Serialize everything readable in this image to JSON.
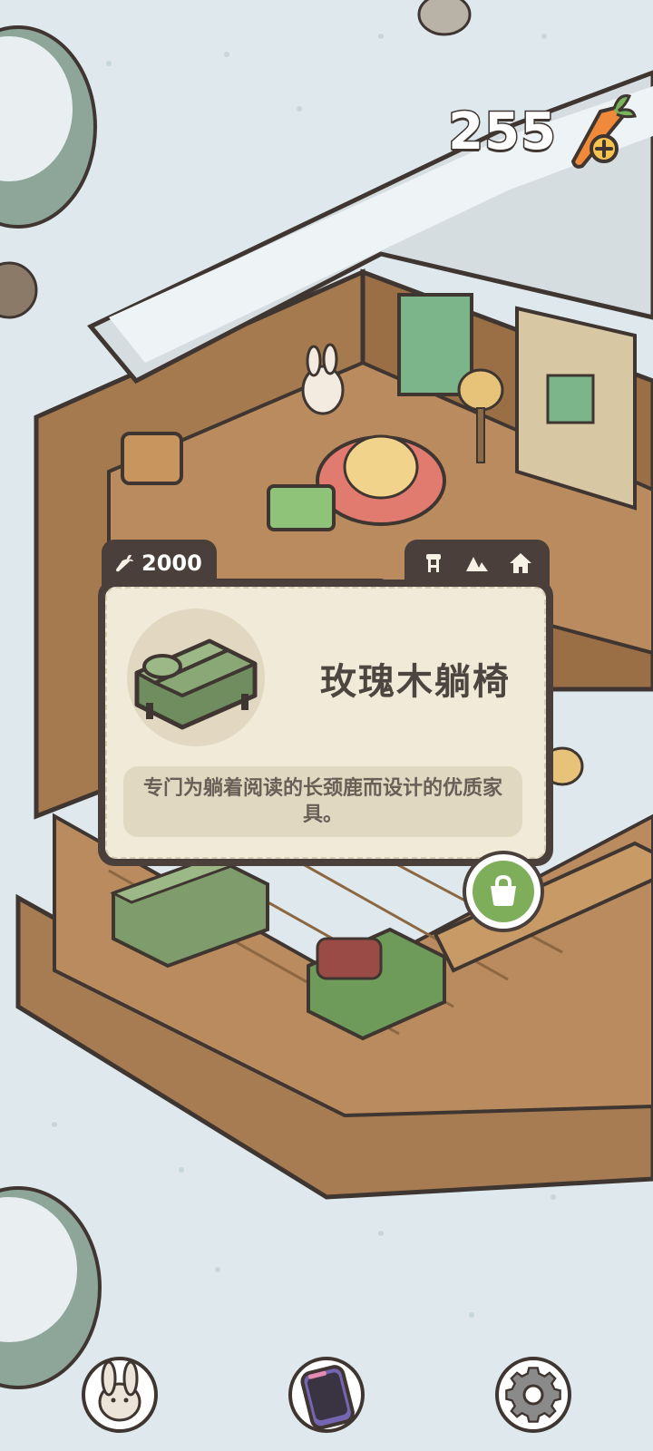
{
  "hud": {
    "carrot_count": "255",
    "carrot_icon": "carrot-plus-icon"
  },
  "item_card": {
    "price": "2000",
    "price_icon": "carrot-icon",
    "category_tabs": [
      {
        "icon": "stool-icon"
      },
      {
        "icon": "mountain-icon"
      },
      {
        "icon": "house-icon"
      }
    ],
    "item_name": "玫瑰木躺椅",
    "item_description": "专门为躺着阅读的长颈鹿而设计的优质家具。",
    "thumbnail_icon": "green-chaise-lounge-icon"
  },
  "actions": {
    "bag_icon": "shopping-bag-icon"
  },
  "dock": [
    {
      "icon": "bunny-icon"
    },
    {
      "icon": "phone-icon"
    },
    {
      "icon": "gear-icon"
    }
  ],
  "colors": {
    "snow_background": "#dfe9ed",
    "panel_dark": "#4a3f3a",
    "card_cream": "#f1ead8",
    "wood": "#b98b5e",
    "accent_green": "#7fae5a",
    "carrot_orange": "#f08a3a"
  }
}
